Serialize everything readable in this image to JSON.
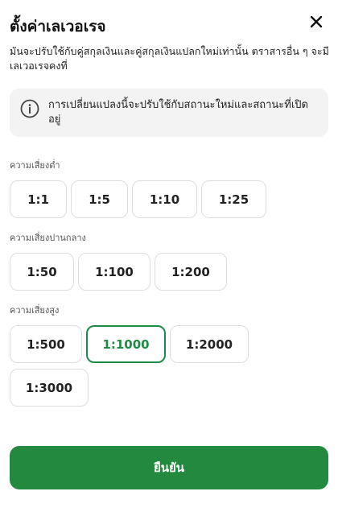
{
  "dialog": {
    "title": "ตั้งค่าเลเวอเรจ",
    "close_icon": "close-icon",
    "subtitle": "มันจะปรับใช้กับคู่สกุลเงินและคู่สกุลเงินแปลกใหม่เท่านั้น ตราสารอื่น ๆ จะมีเลเวอเรจคงที่"
  },
  "notice": {
    "icon": "info-icon",
    "text": "การเปลี่ยนแปลงนี้จะปรับใช้กับสถานะใหม่และสถานะที่เปิดอยู่"
  },
  "sections": [
    {
      "label": "ความเสี่ยงต่ำ",
      "options": [
        "1:1",
        "1:5",
        "1:10",
        "1:25"
      ]
    },
    {
      "label": "ความเสี่ยงปานกลาง",
      "options": [
        "1:50",
        "1:100",
        "1:200"
      ]
    },
    {
      "label": "ความเสี่ยงสูง",
      "options": [
        "1:500",
        "1:1000",
        "1:2000",
        "1:3000"
      ]
    }
  ],
  "selected_leverage": "1:1000",
  "colors": {
    "accent": "#1f8a45",
    "confirm_button": "#23893f",
    "notice_background": "#f3f3f3",
    "button_border": "#dddddd"
  },
  "confirm_button": {
    "label": "ยืนยัน"
  }
}
